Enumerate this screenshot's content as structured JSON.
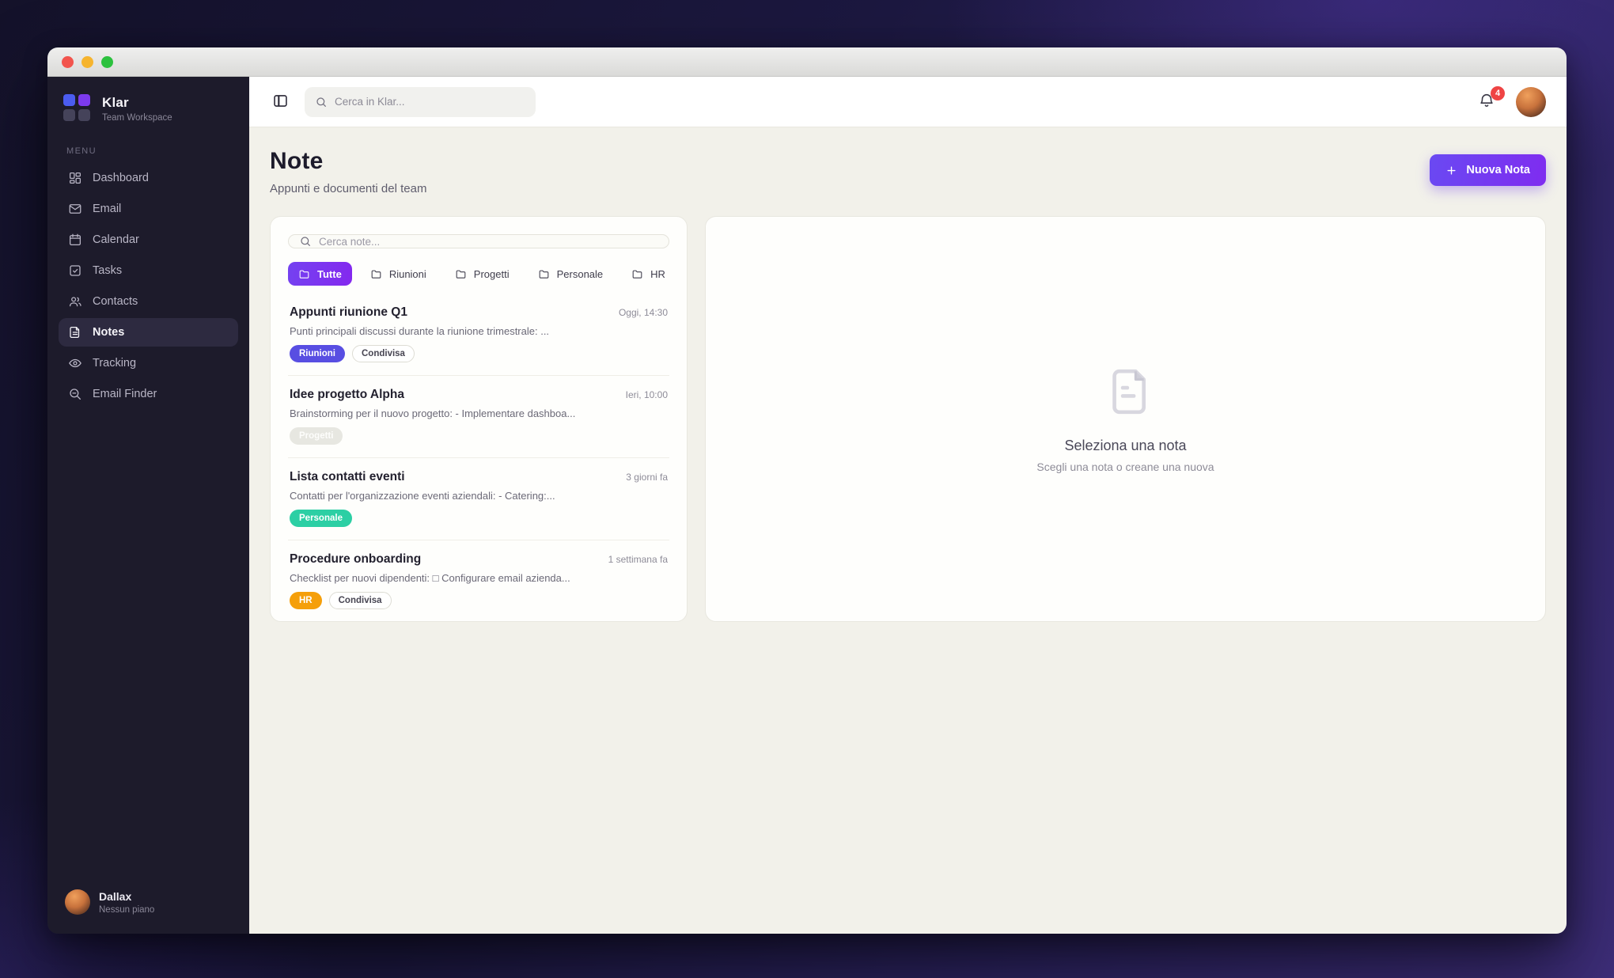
{
  "window": {
    "controls": [
      "close",
      "minimize",
      "maximize"
    ]
  },
  "sidebar": {
    "workspace": {
      "name": "Klar",
      "subtitle": "Team Workspace"
    },
    "menu_label": "MENU",
    "items": [
      {
        "label": "Dashboard",
        "icon": "dashboard-icon",
        "active": false
      },
      {
        "label": "Email",
        "icon": "mail-icon",
        "active": false
      },
      {
        "label": "Calendar",
        "icon": "calendar-icon",
        "active": false
      },
      {
        "label": "Tasks",
        "icon": "task-check-icon",
        "active": false
      },
      {
        "label": "Contacts",
        "icon": "users-icon",
        "active": false
      },
      {
        "label": "Notes",
        "icon": "file-text-icon",
        "active": true
      },
      {
        "label": "Tracking",
        "icon": "eye-icon",
        "active": false
      },
      {
        "label": "Email Finder",
        "icon": "search-find-icon",
        "active": false
      }
    ],
    "user": {
      "name": "Dallax",
      "plan": "Nessun piano"
    }
  },
  "topbar": {
    "search_placeholder": "Cerca in Klar...",
    "notification_count": "4"
  },
  "page": {
    "title": "Note",
    "subtitle": "Appunti e documenti del team",
    "new_note_button": "Nuova Nota"
  },
  "notes_panel": {
    "search_placeholder": "Cerca note...",
    "filters": [
      {
        "label": "Tutte",
        "icon": "folder-icon",
        "active": true
      },
      {
        "label": "Riunioni",
        "icon": "folder-icon",
        "active": false
      },
      {
        "label": "Progetti",
        "icon": "folder-icon",
        "active": false
      },
      {
        "label": "Personale",
        "icon": "folder-icon",
        "active": false
      },
      {
        "label": "HR",
        "icon": "folder-icon",
        "active": false
      }
    ],
    "notes": [
      {
        "title": "Appunti riunione Q1",
        "time": "Oggi, 14:30",
        "snippet": "Punti principali discussi durante la riunione trimestrale: ...",
        "badges": [
          {
            "label": "Riunioni",
            "style": "indigo"
          },
          {
            "label": "Condivisa",
            "style": "outline"
          }
        ]
      },
      {
        "title": "Idee progetto Alpha",
        "time": "Ieri, 10:00",
        "snippet": "Brainstorming per il nuovo progetto: - Implementare dashboa...",
        "badges": [
          {
            "label": "Progetti",
            "style": "faint"
          }
        ]
      },
      {
        "title": "Lista contatti eventi",
        "time": "3 giorni fa",
        "snippet": "Contatti per l'organizzazione eventi aziendali: - Catering:...",
        "badges": [
          {
            "label": "Personale",
            "style": "teal"
          }
        ]
      },
      {
        "title": "Procedure onboarding",
        "time": "1 settimana fa",
        "snippet": "Checklist per nuovi dipendenti: □ Configurare email azienda...",
        "badges": [
          {
            "label": "HR",
            "style": "orange"
          },
          {
            "label": "Condivisa",
            "style": "outline"
          }
        ]
      }
    ]
  },
  "detail_panel": {
    "empty_title": "Seleziona una nota",
    "empty_subtitle": "Scegli una nota o creane una nuova"
  },
  "colors": {
    "accent": "#7c3aed",
    "sidebar_bg": "#1d1b2b",
    "content_bg": "#f2f1ea",
    "badge_indigo": "#584ee2",
    "badge_teal": "#2ccfa4",
    "badge_orange": "#f59f0a",
    "notification_red": "#ef4444",
    "logo_blue": "#4b5cf0",
    "logo_purple": "#7c3aed"
  }
}
